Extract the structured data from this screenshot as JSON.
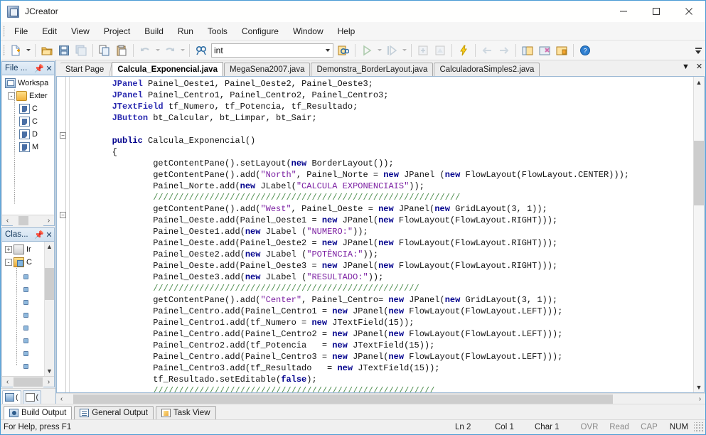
{
  "window": {
    "title": "JCreator",
    "app_icon": "jcreator-logo-icon",
    "minimize_label": "Minimize",
    "maximize_label": "Maximize",
    "close_label": "Close"
  },
  "menubar": {
    "items": [
      {
        "label": "File"
      },
      {
        "label": "Edit"
      },
      {
        "label": "View"
      },
      {
        "label": "Project"
      },
      {
        "label": "Build"
      },
      {
        "label": "Run"
      },
      {
        "label": "Tools"
      },
      {
        "label": "Configure"
      },
      {
        "label": "Window"
      },
      {
        "label": "Help"
      }
    ]
  },
  "toolbar": {
    "find_value": "int",
    "find_placeholder": "",
    "buttons": [
      {
        "name": "new-file-icon",
        "title": "New"
      },
      {
        "name": "open-file-icon",
        "title": "Open"
      },
      {
        "name": "save-icon",
        "title": "Save"
      },
      {
        "name": "save-all-icon",
        "title": "Save All"
      },
      {
        "name": "copy-icon",
        "title": "Copy"
      },
      {
        "name": "paste-icon",
        "title": "Paste"
      },
      {
        "name": "undo-icon",
        "title": "Undo"
      },
      {
        "name": "redo-icon",
        "title": "Redo"
      },
      {
        "name": "find-icon",
        "title": "Find"
      },
      {
        "name": "find-in-files-icon",
        "title": "Find in Files"
      },
      {
        "name": "run-icon",
        "title": "Run Project"
      },
      {
        "name": "run-file-icon",
        "title": "Run File"
      },
      {
        "name": "compile-icon",
        "title": "Compile"
      },
      {
        "name": "compile-project-icon",
        "title": "Compile Project"
      },
      {
        "name": "build-icon",
        "title": "Build"
      },
      {
        "name": "back-icon",
        "title": "Back"
      },
      {
        "name": "forward-icon",
        "title": "Forward"
      },
      {
        "name": "file-view-icon",
        "title": "File View"
      },
      {
        "name": "class-view-icon",
        "title": "Class View"
      },
      {
        "name": "package-view-icon",
        "title": "Package View"
      },
      {
        "name": "help-icon",
        "title": "Help"
      }
    ]
  },
  "left_dock": {
    "file_panel": {
      "title": "File ...",
      "pin_icon": "pin-icon",
      "close_icon": "close-icon",
      "tree": [
        {
          "label": "Workspa",
          "icon": "workspace-icon",
          "depth": 0,
          "expander": ""
        },
        {
          "label": "Exter",
          "icon": "folder-icon",
          "depth": 1,
          "expander": "-"
        },
        {
          "label": "C",
          "icon": "java-file-icon",
          "depth": 2,
          "expander": ""
        },
        {
          "label": "C",
          "icon": "java-file-icon",
          "depth": 2,
          "expander": ""
        },
        {
          "label": "D",
          "icon": "java-file-icon",
          "depth": 2,
          "expander": ""
        },
        {
          "label": "M",
          "icon": "java-file-icon",
          "depth": 2,
          "expander": ""
        }
      ]
    },
    "class_panel": {
      "title": "Clas...",
      "pin_icon": "pin-icon",
      "close_icon": "close-icon",
      "tree": [
        {
          "label": "Ir",
          "icon": "package-icon",
          "depth": 0,
          "expander": "+"
        },
        {
          "label": "C",
          "icon": "class-icon",
          "depth": 0,
          "expander": "-"
        },
        {
          "label": "",
          "icon": "member-icon",
          "depth": 1,
          "expander": ""
        },
        {
          "label": "",
          "icon": "member-icon",
          "depth": 1,
          "expander": ""
        },
        {
          "label": "",
          "icon": "member-icon",
          "depth": 1,
          "expander": ""
        },
        {
          "label": "",
          "icon": "member-icon",
          "depth": 1,
          "expander": ""
        },
        {
          "label": "",
          "icon": "member-icon",
          "depth": 1,
          "expander": ""
        },
        {
          "label": "",
          "icon": "member-icon",
          "depth": 1,
          "expander": ""
        },
        {
          "label": "",
          "icon": "member-icon",
          "depth": 1,
          "expander": ""
        },
        {
          "label": "",
          "icon": "member-icon",
          "depth": 1,
          "expander": ""
        },
        {
          "label": "",
          "icon": "member-icon",
          "depth": 1,
          "expander": ""
        }
      ]
    },
    "dock_tabs": [
      {
        "label": "(",
        "icon": "file-view-tab-icon",
        "active": true
      },
      {
        "label": "(",
        "icon": "class-view-tab-icon",
        "active": false
      }
    ]
  },
  "editor_tabs": {
    "items": [
      {
        "label": "Start Page",
        "active": false,
        "first": true
      },
      {
        "label": "Calcula_Exponencial.java",
        "active": true,
        "first": false
      },
      {
        "label": "MegaSena2007.java",
        "active": false,
        "first": false
      },
      {
        "label": "Demonstra_BorderLayout.java",
        "active": false,
        "first": false
      },
      {
        "label": "CalculadoraSimples2.java",
        "active": false,
        "first": false
      }
    ],
    "dropdown_icon": "chevron-down-icon",
    "close_icon": "close-icon"
  },
  "code": {
    "lines": [
      [
        {
          "t": "        ",
          "c": "pln"
        },
        {
          "t": "JPanel",
          "c": "typ"
        },
        {
          "t": " Painel_Oeste1, Painel_Oeste2, Painel_Oeste3;",
          "c": "pln"
        }
      ],
      [
        {
          "t": "        ",
          "c": "pln"
        },
        {
          "t": "JPanel",
          "c": "typ"
        },
        {
          "t": " Painel_Centro1, Painel_Centro2, Painel_Centro3;",
          "c": "pln"
        }
      ],
      [
        {
          "t": "        ",
          "c": "pln"
        },
        {
          "t": "JTextField",
          "c": "typ"
        },
        {
          "t": " tf_Numero, tf_Potencia, tf_Resultado;",
          "c": "pln"
        }
      ],
      [
        {
          "t": "        ",
          "c": "pln"
        },
        {
          "t": "JButton",
          "c": "typ"
        },
        {
          "t": " bt_Calcular, bt_Limpar, bt_Sair;",
          "c": "pln"
        }
      ],
      [
        {
          "t": "",
          "c": "pln"
        }
      ],
      [
        {
          "t": "        ",
          "c": "pln"
        },
        {
          "t": "public",
          "c": "kw"
        },
        {
          "t": " Calcula_Exponencial()",
          "c": "pln"
        }
      ],
      [
        {
          "t": "        {",
          "c": "pln"
        }
      ],
      [
        {
          "t": "                getContentPane().setLayout(",
          "c": "pln"
        },
        {
          "t": "new",
          "c": "kw"
        },
        {
          "t": " BorderLayout());",
          "c": "pln"
        }
      ],
      [
        {
          "t": "                getContentPane().add(",
          "c": "pln"
        },
        {
          "t": "\"North\"",
          "c": "str"
        },
        {
          "t": ", Painel_Norte = ",
          "c": "pln"
        },
        {
          "t": "new",
          "c": "kw"
        },
        {
          "t": " JPanel (",
          "c": "pln"
        },
        {
          "t": "new",
          "c": "kw"
        },
        {
          "t": " FlowLayout(FlowLayout.CENTER)));",
          "c": "pln"
        }
      ],
      [
        {
          "t": "                Painel_Norte.add(",
          "c": "pln"
        },
        {
          "t": "new",
          "c": "kw"
        },
        {
          "t": " JLabel(",
          "c": "pln"
        },
        {
          "t": "\"CALCULA EXPONENCIAIS\"",
          "c": "str"
        },
        {
          "t": "));",
          "c": "pln"
        }
      ],
      [
        {
          "t": "                ////////////////////////////////////////////////////////////",
          "c": "cmt"
        }
      ],
      [
        {
          "t": "                getContentPane().add(",
          "c": "pln"
        },
        {
          "t": "\"West\"",
          "c": "str"
        },
        {
          "t": ", Painel_Oeste = ",
          "c": "pln"
        },
        {
          "t": "new",
          "c": "kw"
        },
        {
          "t": " JPanel(",
          "c": "pln"
        },
        {
          "t": "new",
          "c": "kw"
        },
        {
          "t": " GridLayout(3, 1));",
          "c": "pln"
        }
      ],
      [
        {
          "t": "                Painel_Oeste.add(Painel_Oeste1 = ",
          "c": "pln"
        },
        {
          "t": "new",
          "c": "kw"
        },
        {
          "t": " JPanel(",
          "c": "pln"
        },
        {
          "t": "new",
          "c": "kw"
        },
        {
          "t": " FlowLayout(FlowLayout.RIGHT)));",
          "c": "pln"
        }
      ],
      [
        {
          "t": "                Painel_Oeste1.add(",
          "c": "pln"
        },
        {
          "t": "new",
          "c": "kw"
        },
        {
          "t": " JLabel (",
          "c": "pln"
        },
        {
          "t": "\"NUMERO:\"",
          "c": "str"
        },
        {
          "t": "));",
          "c": "pln"
        }
      ],
      [
        {
          "t": "                Painel_Oeste.add(Painel_Oeste2 = ",
          "c": "pln"
        },
        {
          "t": "new",
          "c": "kw"
        },
        {
          "t": " JPanel(",
          "c": "pln"
        },
        {
          "t": "new",
          "c": "kw"
        },
        {
          "t": " FlowLayout(FlowLayout.RIGHT)));",
          "c": "pln"
        }
      ],
      [
        {
          "t": "                Painel_Oeste2.add(",
          "c": "pln"
        },
        {
          "t": "new",
          "c": "kw"
        },
        {
          "t": " JLabel (",
          "c": "pln"
        },
        {
          "t": "\"POTÊNCIA:\"",
          "c": "str"
        },
        {
          "t": "));",
          "c": "pln"
        }
      ],
      [
        {
          "t": "                Painel_Oeste.add(Painel_Oeste3 = ",
          "c": "pln"
        },
        {
          "t": "new",
          "c": "kw"
        },
        {
          "t": " JPanel(",
          "c": "pln"
        },
        {
          "t": "new",
          "c": "kw"
        },
        {
          "t": " FlowLayout(FlowLayout.RIGHT)));",
          "c": "pln"
        }
      ],
      [
        {
          "t": "                Painel_Oeste3.add(",
          "c": "pln"
        },
        {
          "t": "new",
          "c": "kw"
        },
        {
          "t": " JLabel (",
          "c": "pln"
        },
        {
          "t": "\"RESULTADO:\"",
          "c": "str"
        },
        {
          "t": "));",
          "c": "pln"
        }
      ],
      [
        {
          "t": "                ////////////////////////////////////////////////////",
          "c": "cmt"
        }
      ],
      [
        {
          "t": "                getContentPane().add(",
          "c": "pln"
        },
        {
          "t": "\"Center\"",
          "c": "str"
        },
        {
          "t": ", Painel_Centro= ",
          "c": "pln"
        },
        {
          "t": "new",
          "c": "kw"
        },
        {
          "t": " JPanel(",
          "c": "pln"
        },
        {
          "t": "new",
          "c": "kw"
        },
        {
          "t": " GridLayout(3, 1));",
          "c": "pln"
        }
      ],
      [
        {
          "t": "                Painel_Centro.add(Painel_Centro1 = ",
          "c": "pln"
        },
        {
          "t": "new",
          "c": "kw"
        },
        {
          "t": " JPanel(",
          "c": "pln"
        },
        {
          "t": "new",
          "c": "kw"
        },
        {
          "t": " FlowLayout(FlowLayout.LEFT)));",
          "c": "pln"
        }
      ],
      [
        {
          "t": "                Painel_Centro1.add(tf_Numero = ",
          "c": "pln"
        },
        {
          "t": "new",
          "c": "kw"
        },
        {
          "t": " JTextField(15));",
          "c": "pln"
        }
      ],
      [
        {
          "t": "                Painel_Centro.add(Painel_Centro2 = ",
          "c": "pln"
        },
        {
          "t": "new",
          "c": "kw"
        },
        {
          "t": " JPanel(",
          "c": "pln"
        },
        {
          "t": "new",
          "c": "kw"
        },
        {
          "t": " FlowLayout(FlowLayout.LEFT)));",
          "c": "pln"
        }
      ],
      [
        {
          "t": "                Painel_Centro2.add(tf_Potencia   = ",
          "c": "pln"
        },
        {
          "t": "new",
          "c": "kw"
        },
        {
          "t": " JTextField(15));",
          "c": "pln"
        }
      ],
      [
        {
          "t": "                Painel_Centro.add(Painel_Centro3 = ",
          "c": "pln"
        },
        {
          "t": "new",
          "c": "kw"
        },
        {
          "t": " JPanel(",
          "c": "pln"
        },
        {
          "t": "new",
          "c": "kw"
        },
        {
          "t": " FlowLayout(FlowLayout.LEFT)));",
          "c": "pln"
        }
      ],
      [
        {
          "t": "                Painel_Centro3.add(tf_Resultado   = ",
          "c": "pln"
        },
        {
          "t": "new",
          "c": "kw"
        },
        {
          "t": " JTextField(15));",
          "c": "pln"
        }
      ],
      [
        {
          "t": "                tf_Resultado.setEditable(",
          "c": "pln"
        },
        {
          "t": "false",
          "c": "kw"
        },
        {
          "t": ");",
          "c": "pln"
        }
      ],
      [
        {
          "t": "                ///////////////////////////////////////////////////////",
          "c": "cmt"
        }
      ]
    ]
  },
  "bottom_tabs": [
    {
      "label": "Build Output",
      "icon": "build-output-icon",
      "active": true
    },
    {
      "label": "General Output",
      "icon": "general-output-icon",
      "active": false
    },
    {
      "label": "Task View",
      "icon": "task-view-icon",
      "active": false
    }
  ],
  "statusbar": {
    "help": "For Help, press F1",
    "line": "Ln 2",
    "col": "Col 1",
    "char": "Char 1",
    "ovr": "OVR",
    "read": "Read",
    "cap": "CAP",
    "num": "NUM"
  },
  "colors": {
    "window_border": "#4a9ad4",
    "keyword": "#00008c",
    "type": "#2b2bb0",
    "string": "#7b1fa2",
    "comment": "#4f8f4f",
    "panel_header": "#cfe0f0",
    "toolbar_bg": "#f6f6f6"
  }
}
